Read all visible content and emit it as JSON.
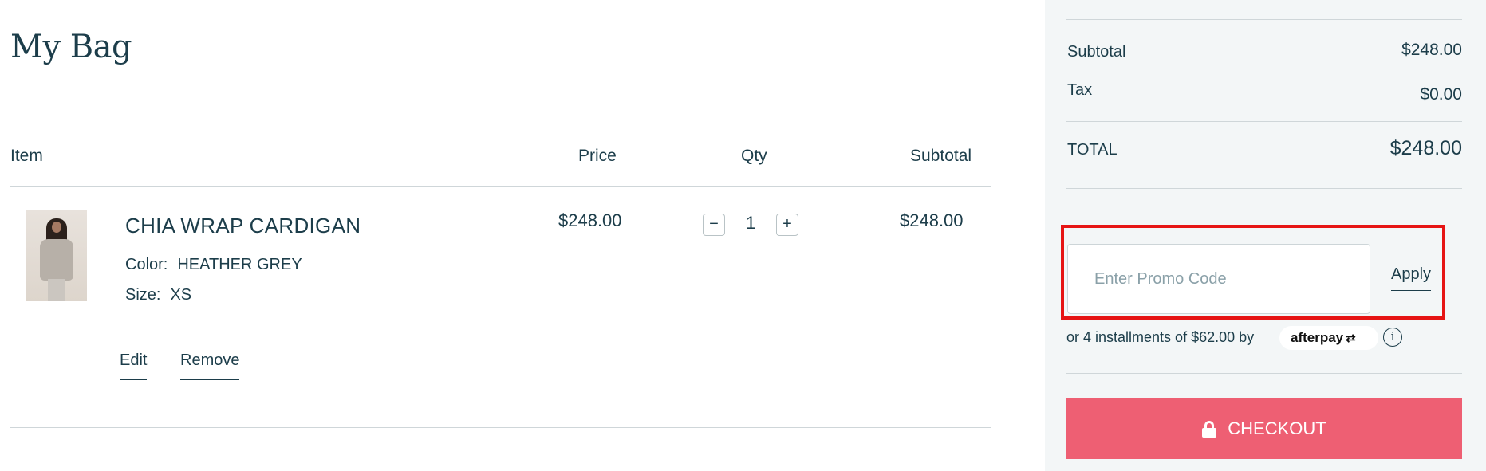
{
  "page": {
    "title": "My Bag"
  },
  "table": {
    "headers": {
      "item": "Item",
      "price": "Price",
      "qty": "Qty",
      "subtotal": "Subtotal"
    }
  },
  "cart_item": {
    "name": "CHIA WRAP CARDIGAN",
    "color_label": "Color:",
    "color_value": "HEATHER GREY",
    "size_label": "Size:",
    "size_value": "XS",
    "price": "$248.00",
    "qty": "1",
    "subtotal": "$248.00",
    "edit_label": "Edit",
    "remove_label": "Remove",
    "decrement_symbol": "−",
    "increment_symbol": "+"
  },
  "summary": {
    "subtotal_label": "Subtotal",
    "subtotal_value": "$248.00",
    "tax_label": "Tax",
    "tax_value": "$0.00",
    "total_label": "TOTAL",
    "total_value": "$248.00"
  },
  "promo": {
    "placeholder": "Enter Promo Code",
    "value": "",
    "apply_label": "Apply"
  },
  "afterpay": {
    "text": "or 4 installments of $62.00 by",
    "logo_text": "afterpay",
    "info_symbol": "i"
  },
  "checkout": {
    "label": "CHECKOUT",
    "icon": "lock-icon"
  },
  "colors": {
    "primary_text": "#1c3d4a",
    "checkout_bg": "#ee5f73",
    "summary_bg": "#f3f6f7",
    "highlight_border": "#e61414"
  }
}
